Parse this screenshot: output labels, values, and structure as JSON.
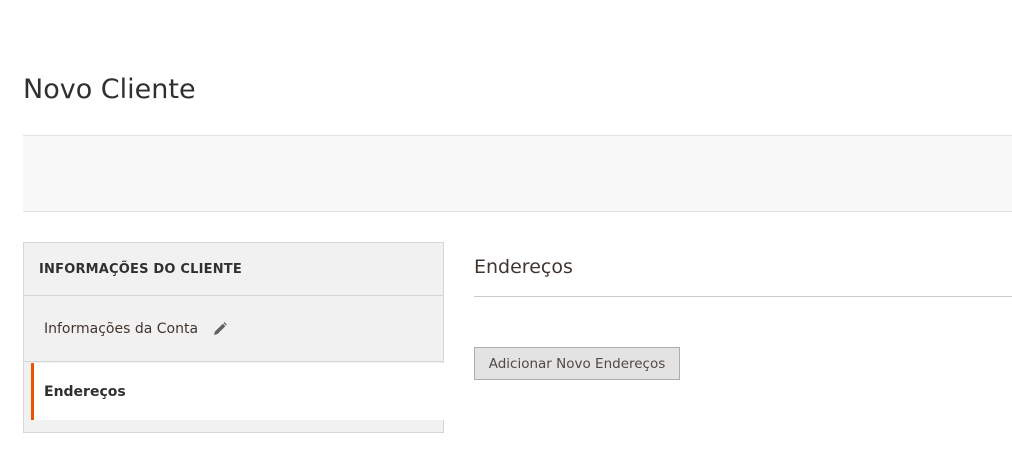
{
  "page": {
    "title": "Novo Cliente"
  },
  "sidebar": {
    "header": "INFORMAÇÕES DO CLIENTE",
    "items": [
      {
        "label": "Informações da Conta",
        "icon": "pencil-icon",
        "active": false
      },
      {
        "label": "Endereços",
        "active": true
      }
    ]
  },
  "main": {
    "section_title": "Endereços",
    "add_button_label": "Adicionar Novo Endereços"
  },
  "colors": {
    "accent": "#eb5202",
    "panel_bg": "#f1f1f1",
    "button_bg": "#e3e3e3"
  }
}
